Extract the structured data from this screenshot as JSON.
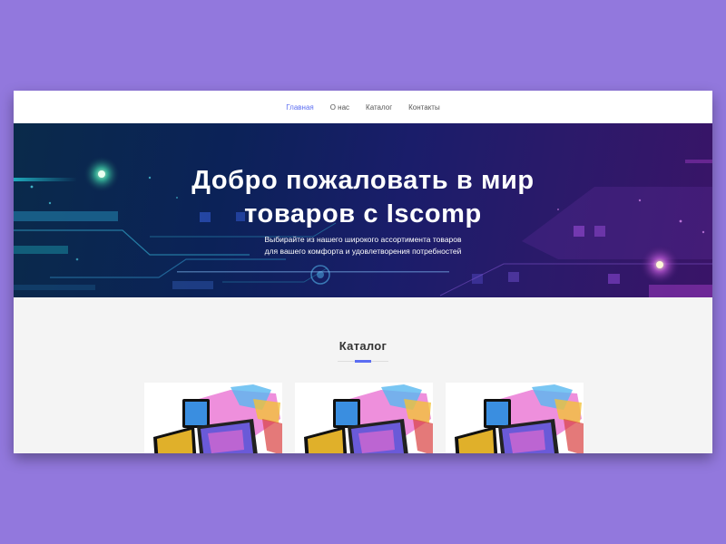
{
  "nav": {
    "items": [
      {
        "label": "Главная",
        "active": true
      },
      {
        "label": "О нас",
        "active": false
      },
      {
        "label": "Каталог",
        "active": false
      },
      {
        "label": "Контакты",
        "active": false
      }
    ]
  },
  "hero": {
    "title_line1": "Добро пожаловать в мир",
    "title_line2": "товаров с Iscomp",
    "subtitle_line1": "Выбирайте из нашего широкого ассортимента товаров",
    "subtitle_line2": "для вашего комфорта и удовлетворения потребностей"
  },
  "catalog": {
    "title": "Каталог",
    "products": [
      {
        "image": "laptops-tablets-image"
      },
      {
        "image": "laptops-tablets-image"
      },
      {
        "image": "laptops-tablets-image"
      }
    ]
  },
  "colors": {
    "page_background": "#9278dd",
    "accent": "#5b6df2",
    "hero_start": "#0a2a4a",
    "hero_end": "#3a1468"
  }
}
